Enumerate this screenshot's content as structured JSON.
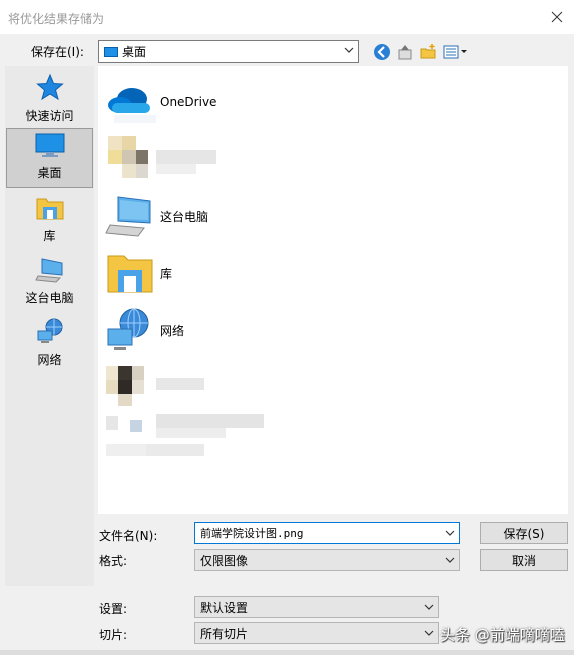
{
  "window": {
    "title": "将优化结果存储为"
  },
  "toolbar": {
    "save_in_label": "保存在(I):",
    "location": "桌面",
    "icons": [
      "back-icon",
      "up-folder-icon",
      "new-folder-icon",
      "view-menu-icon"
    ]
  },
  "places": [
    {
      "label": "快速访问",
      "icon": "star-icon"
    },
    {
      "label": "桌面",
      "icon": "desktop-icon",
      "selected": true
    },
    {
      "label": "库",
      "icon": "library-icon"
    },
    {
      "label": "这台电脑",
      "icon": "computer-icon"
    },
    {
      "label": "网络",
      "icon": "network-icon"
    }
  ],
  "files": [
    {
      "label": "OneDrive",
      "icon": "onedrive-icon"
    },
    {
      "label": "这台电脑",
      "icon": "computer-icon"
    },
    {
      "label": "库",
      "icon": "library-icon"
    },
    {
      "label": "网络",
      "icon": "network-icon"
    }
  ],
  "form": {
    "filename_label": "文件名(N):",
    "filename_value": "前端学院设计图.png",
    "format_label": "格式:",
    "format_value": "仅限图像",
    "settings_label": "设置:",
    "settings_value": "默认设置",
    "slices_label": "切片:",
    "slices_value": "所有切片"
  },
  "buttons": {
    "save": "保存(S)",
    "cancel": "取消"
  },
  "watermark": "头条 @前端嘀嘀嗑",
  "colors": {
    "accent": "#0078d7",
    "folder": "#f4c542",
    "desktop": "#1e90e6"
  }
}
